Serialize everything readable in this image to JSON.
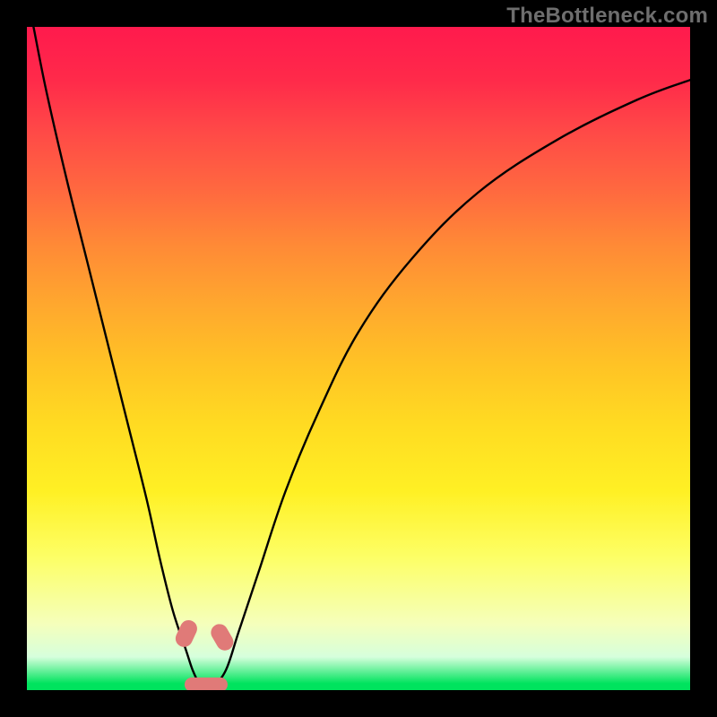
{
  "watermark": {
    "text": "TheBottleneck.com"
  },
  "chart_data": {
    "type": "line",
    "title": "",
    "xlabel": "",
    "ylabel": "",
    "x_range": [
      0,
      100
    ],
    "y_range": [
      0,
      100
    ],
    "background_gradient": {
      "direction": "vertical",
      "stops": [
        {
          "pos": 0,
          "color": "#ff1a4d",
          "meaning": "high-bottleneck"
        },
        {
          "pos": 50,
          "color": "#ffc325",
          "meaning": "moderate"
        },
        {
          "pos": 80,
          "color": "#fdff66",
          "meaning": "low"
        },
        {
          "pos": 99,
          "color": "#00e35e",
          "meaning": "no-bottleneck"
        },
        {
          "pos": 100,
          "color": "#00e35e",
          "meaning": "no-bottleneck"
        }
      ]
    },
    "series": [
      {
        "name": "bottleneck-curve",
        "x": [
          1,
          3,
          6,
          9,
          12,
          15,
          18,
          20,
          22,
          24,
          25,
          26,
          27,
          28,
          30,
          32,
          35,
          39,
          44,
          50,
          58,
          68,
          80,
          92,
          100
        ],
        "y": [
          100,
          90,
          77,
          65,
          53,
          41,
          29,
          20,
          12,
          6,
          3,
          1,
          0,
          0.5,
          3,
          9,
          18,
          30,
          42,
          54,
          65,
          75,
          83,
          89,
          92
        ]
      }
    ],
    "markers": [
      {
        "name": "left-marker-top",
        "x": 24.0,
        "y": 8.5,
        "w_pct": 2.6,
        "h_pct": 4.2,
        "rot": 25
      },
      {
        "name": "right-marker-top",
        "x": 29.5,
        "y": 8.0,
        "w_pct": 2.6,
        "h_pct": 4.2,
        "rot": -30
      },
      {
        "name": "bottom-marker",
        "x": 27.0,
        "y": 0.8,
        "w_pct": 6.5,
        "h_pct": 2.2,
        "rot": 0
      }
    ],
    "minimum_at_x": 27,
    "note": "Values are visual estimates read from the unlabeled plot; y=0 at the green baseline, y=100 at the top red edge."
  }
}
